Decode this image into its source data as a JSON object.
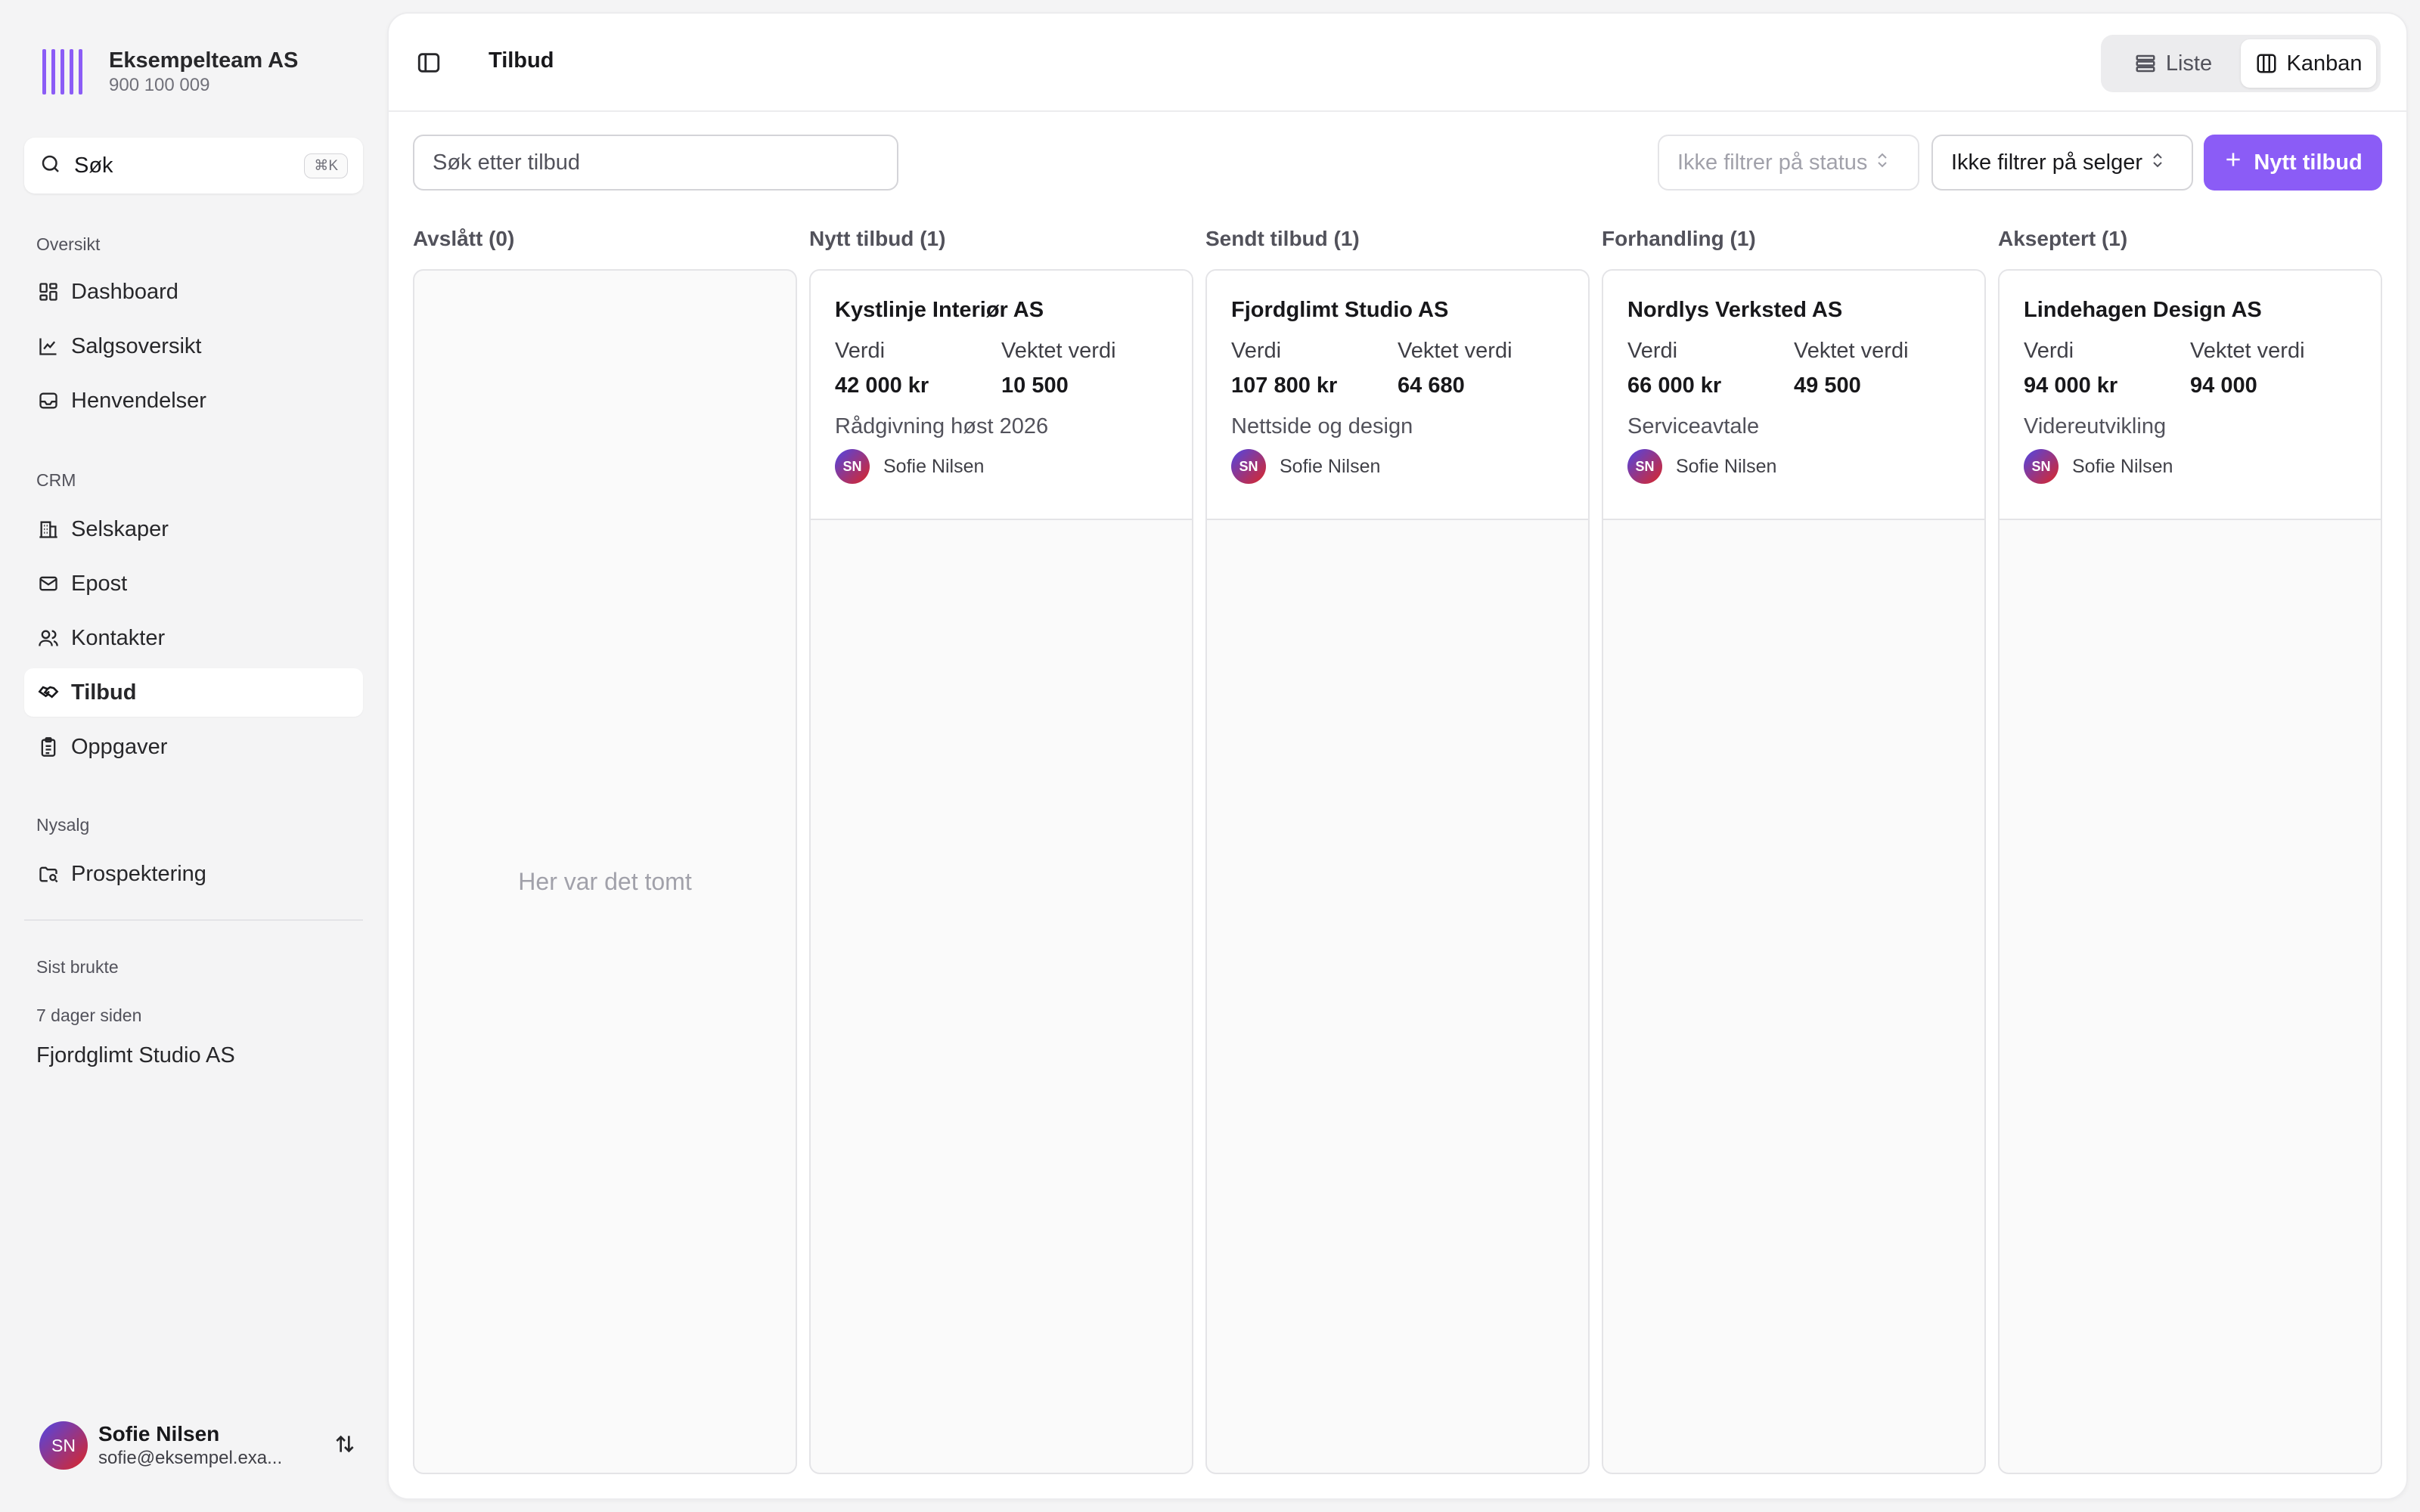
{
  "brand": {
    "name": "Eksempelteam AS",
    "org_number": "900 100 009",
    "accent": "#8b5cf6"
  },
  "search": {
    "label": "Søk",
    "shortcut": "⌘K"
  },
  "nav": {
    "overview_label": "Oversikt",
    "overview": [
      {
        "label": "Dashboard",
        "icon": "dashboard-icon"
      },
      {
        "label": "Salgsoversikt",
        "icon": "chart-line-icon"
      },
      {
        "label": "Henvendelser",
        "icon": "inbox-icon"
      }
    ],
    "crm_label": "CRM",
    "crm": [
      {
        "label": "Selskaper",
        "icon": "building-icon"
      },
      {
        "label": "Epost",
        "icon": "mail-icon"
      },
      {
        "label": "Kontakter",
        "icon": "users-icon"
      },
      {
        "label": "Tilbud",
        "icon": "handshake-icon",
        "active": true
      },
      {
        "label": "Oppgaver",
        "icon": "clipboard-icon"
      }
    ],
    "nysalg_label": "Nysalg",
    "nysalg": [
      {
        "label": "Prospektering",
        "icon": "folder-search-icon"
      }
    ]
  },
  "recent": {
    "label": "Sist brukte",
    "when": "7 dager siden",
    "items": [
      "Fjordglimt Studio AS"
    ]
  },
  "user": {
    "initials": "SN",
    "name": "Sofie Nilsen",
    "email": "sofie@eksempel.exa..."
  },
  "header": {
    "title": "Tilbud"
  },
  "view_switch": {
    "list_label": "Liste",
    "kanban_label": "Kanban",
    "active": "Kanban"
  },
  "filters": {
    "search_placeholder": "Søk etter tilbud",
    "status": "Ikke filtrer på status",
    "seller": "Ikke filtrer på selger",
    "new_button": "Nytt tilbud"
  },
  "board": {
    "empty_text": "Her var det tomt",
    "value_label": "Verdi",
    "weighted_label": "Vektet verdi",
    "columns": [
      {
        "title": "Avslått (0)",
        "cards": []
      },
      {
        "title": "Nytt tilbud (1)",
        "cards": [
          {
            "company": "Kystlinje Interiør AS",
            "value": "42 000 kr",
            "weighted": "10 500",
            "description": "Rådgivning høst 2026",
            "owner": "Sofie Nilsen",
            "owner_initials": "SN"
          }
        ]
      },
      {
        "title": "Sendt tilbud (1)",
        "cards": [
          {
            "company": "Fjordglimt Studio AS",
            "value": "107 800 kr",
            "weighted": "64 680",
            "description": "Nettside og design",
            "owner": "Sofie Nilsen",
            "owner_initials": "SN"
          }
        ]
      },
      {
        "title": "Forhandling (1)",
        "cards": [
          {
            "company": "Nordlys Verksted AS",
            "value": "66 000 kr",
            "weighted": "49 500",
            "description": "Serviceavtale",
            "owner": "Sofie Nilsen",
            "owner_initials": "SN"
          }
        ]
      },
      {
        "title": "Akseptert (1)",
        "cards": [
          {
            "company": "Lindehagen Design AS",
            "value": "94 000 kr",
            "weighted": "94 000",
            "description": "Videreutvikling",
            "owner": "Sofie Nilsen",
            "owner_initials": "SN"
          }
        ]
      }
    ]
  }
}
